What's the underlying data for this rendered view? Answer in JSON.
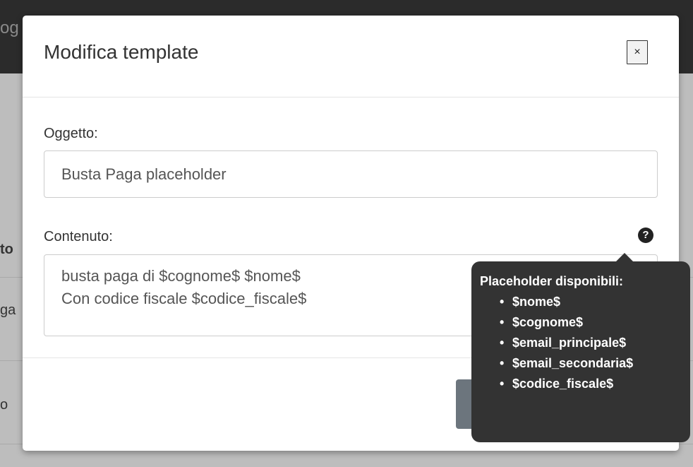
{
  "background": {
    "navbar_text": "og",
    "row_cells": [
      "to",
      "ga",
      "o"
    ]
  },
  "modal": {
    "title": "Modifica template",
    "close_label": "×",
    "subject_label": "Oggetto:",
    "subject_value": "Busta Paga placeholder",
    "content_label": "Contenuto:",
    "content_lines": [
      "busta paga di $cognome$ $nome$",
      "Con codice fiscale $codice_fiscale$"
    ],
    "help_icon": "?"
  },
  "tooltip": {
    "title": "Placeholder disponibili:",
    "items": [
      "$nome$",
      "$cognome$",
      "$email_principale$",
      "$email_secondaria$",
      "$codice_fiscale$"
    ]
  },
  "colors": {
    "tooltip_bg": "#333333",
    "footer_button": "#6c757d",
    "navbar": "#2b2b2b"
  }
}
